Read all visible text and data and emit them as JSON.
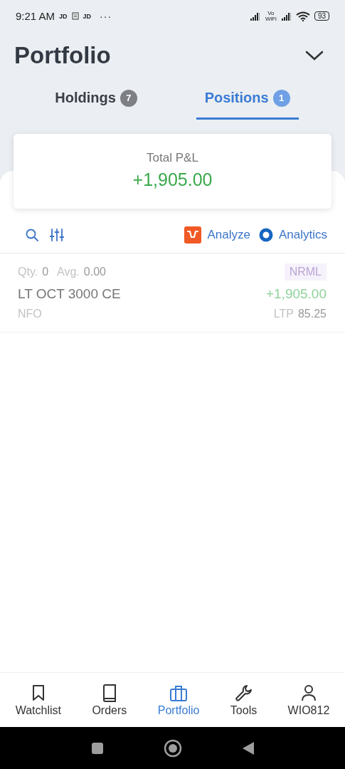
{
  "status_bar": {
    "time": "9:21 AM",
    "notifications": [
      "JD",
      "JD"
    ],
    "more": "···",
    "network_label": "Vo WiFi",
    "battery": "93"
  },
  "title": "Portfolio",
  "tabs": [
    {
      "label": "Holdings",
      "count": "7",
      "selected": false
    },
    {
      "label": "Positions",
      "count": "1",
      "selected": true
    }
  ],
  "summary": {
    "label": "Total P&L",
    "value": "+1,905.00"
  },
  "toolbar": {
    "links": [
      {
        "kind": "analyze",
        "label": "Analyze"
      },
      {
        "kind": "analytics",
        "label": "Analytics"
      }
    ]
  },
  "positions": [
    {
      "qty_label": "Qty.",
      "qty": "0",
      "avg_label": "Avg.",
      "avg": "0.00",
      "product": "NRML",
      "instrument": "LT OCT 3000 CE",
      "pnl": "+1,905.00",
      "exchange": "NFO",
      "ltp_label": "LTP",
      "ltp": "85.25"
    }
  ],
  "nav": [
    {
      "kind": "bookmark",
      "label": "Watchlist",
      "selected": false
    },
    {
      "kind": "book",
      "label": "Orders",
      "selected": false
    },
    {
      "kind": "briefcase",
      "label": "Portfolio",
      "selected": true
    },
    {
      "kind": "wrench",
      "label": "Tools",
      "selected": false
    },
    {
      "kind": "user",
      "label": "WIO812",
      "selected": false
    }
  ]
}
